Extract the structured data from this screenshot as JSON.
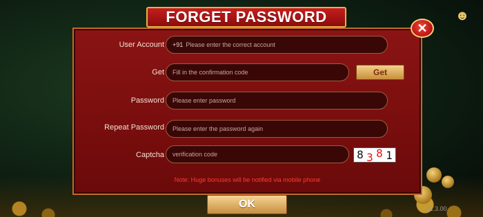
{
  "dialog": {
    "title": "FORGET PASSWORD",
    "close_icon": "close-icon"
  },
  "header": {
    "service_icon": "customer-service-icon"
  },
  "form": {
    "user_account": {
      "label": "User Account",
      "prefix": "+91",
      "placeholder": "Please enter the correct account"
    },
    "get_code": {
      "label": "Get",
      "placeholder": "Fill in the confirmation code",
      "button_label": "Get"
    },
    "password": {
      "label": "Password",
      "placeholder": "Please enter password"
    },
    "repeat_password": {
      "label": "Repeat Password",
      "placeholder": "Please enter the password again"
    },
    "captcha": {
      "label": "Captcha",
      "placeholder": "verification code",
      "digits": [
        "8",
        "3",
        "8",
        "1"
      ]
    }
  },
  "note": "Note: Huge bonuses will be notified via mobile phone",
  "ok_button": "OK",
  "version": "v1.3.00",
  "colors": {
    "panel": "#7a0e0e",
    "accent": "#e9b24a",
    "note": "#ff3c2c",
    "button": "#c98e3d"
  }
}
